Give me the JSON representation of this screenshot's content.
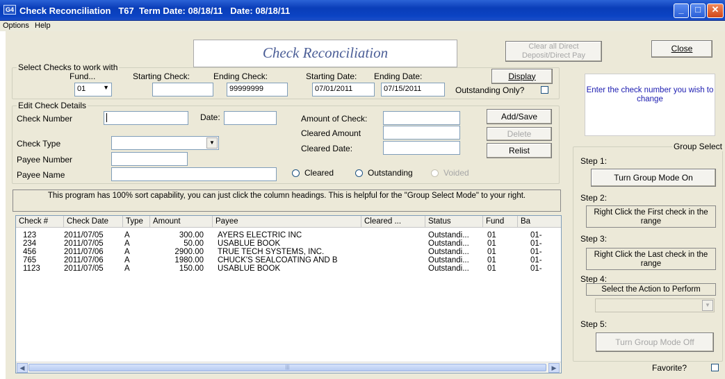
{
  "window": {
    "title": "Check Reconciliation   T67  Term Date: 08/18/11   Date: 08/18/11",
    "app_icon": "G4"
  },
  "menu": [
    "Options",
    "Help"
  ],
  "header": {
    "banner": "Check Reconciliation",
    "clear_direct": "Clear all Direct Deposit/Direct Pay",
    "close": "Close"
  },
  "select_checks": {
    "legend": "Select Checks to work with",
    "fund_label": "Fund...",
    "fund_value": "01",
    "starting_check_label": "Starting Check:",
    "starting_check_value": "",
    "ending_check_label": "Ending Check:",
    "ending_check_value": "99999999",
    "starting_date_label": "Starting Date:",
    "starting_date_value": "07/01/2011",
    "ending_date_label": "Ending Date:",
    "ending_date_value": "07/15/2011",
    "display": "Display",
    "outstanding_only": "Outstanding Only?"
  },
  "edit_details": {
    "legend": "Edit Check Details",
    "check_number_label": "Check Number",
    "date_label": "Date:",
    "amount_label": "Amount of Check:",
    "cleared_amount_label": "Cleared Amount",
    "cleared_date_label": "Cleared Date:",
    "check_type_label": "Check Type",
    "payee_number_label": "Payee Number",
    "payee_name_label": "Payee Name",
    "add_save": "Add/Save",
    "delete": "Delete",
    "relist": "Relist",
    "radio_cleared": "Cleared",
    "radio_outstanding": "Outstanding",
    "radio_voided": "Voided"
  },
  "info_text": "This program has 100% sort capability, you can just click the column headings.  This is helpful for the \"Group Select Mode\" to your right.",
  "grid": {
    "columns": [
      "Check #",
      "Check Date",
      "Type",
      "Amount",
      "Payee",
      "Cleared ...",
      "Status",
      "Fund",
      "Ba"
    ],
    "rows": [
      [
        "123",
        "2011/07/05",
        "A",
        "300.00",
        "AYERS ELECTRIC INC",
        "",
        "Outstandi...",
        "01",
        "01-"
      ],
      [
        "234",
        "2011/07/05",
        "A",
        "50.00",
        "USABLUE BOOK",
        "",
        "Outstandi...",
        "01",
        "01-"
      ],
      [
        "456",
        "2011/07/06",
        "A",
        "2900.00",
        "TRUE TECH SYSTEMS, INC.",
        "",
        "Outstandi...",
        "01",
        "01-"
      ],
      [
        "765",
        "2011/07/06",
        "A",
        "1980.00",
        "CHUCK'S SEALCOATING AND B",
        "",
        "Outstandi...",
        "01",
        "01-"
      ],
      [
        "1123",
        "2011/07/05",
        "A",
        "150.00",
        "USABLUE BOOK",
        "",
        "Outstandi...",
        "01",
        "01-"
      ]
    ]
  },
  "hint": "Enter the check number you wish to change",
  "group_select": {
    "legend": "Group Select",
    "step1": "Step 1:",
    "group_mode_on": "Turn Group Mode On",
    "step2": "Step 2:",
    "step2_text": "Right Click the First check in the range",
    "step3": "Step 3:",
    "step3_text": "Right Click the Last check in the range",
    "step4": "Step 4:",
    "step4_text": "Select the Action to Perform",
    "step5": "Step 5:",
    "group_mode_off": "Turn Group Mode Off"
  },
  "favorite": "Favorite?"
}
